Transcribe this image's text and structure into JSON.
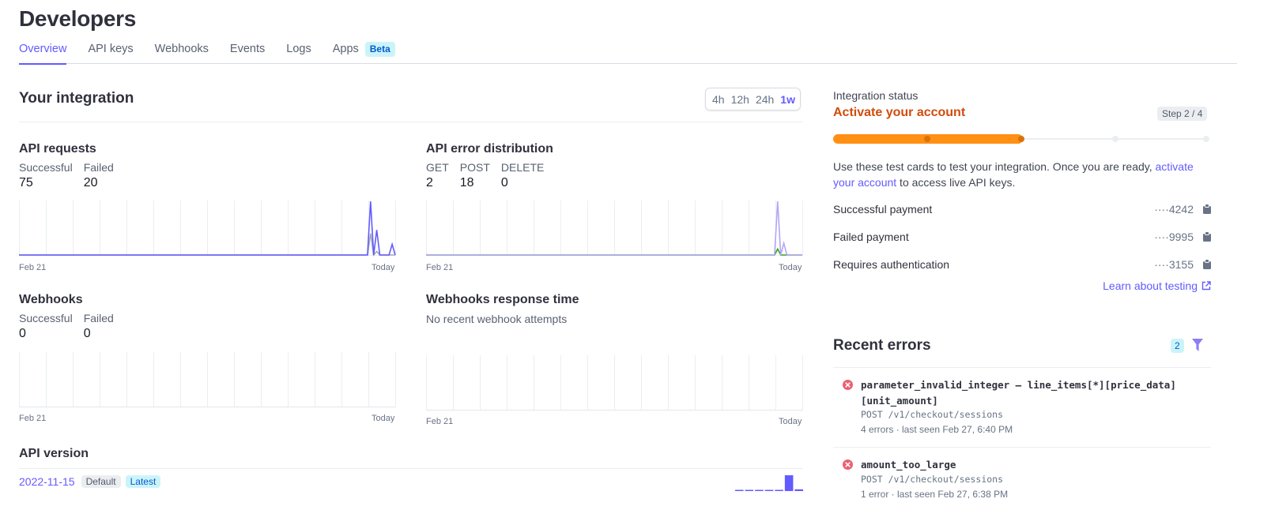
{
  "page": {
    "title": "Developers"
  },
  "tabs": [
    {
      "label": "Overview",
      "active": true
    },
    {
      "label": "API keys"
    },
    {
      "label": "Webhooks"
    },
    {
      "label": "Events"
    },
    {
      "label": "Logs"
    },
    {
      "label": "Apps",
      "badge": "Beta"
    }
  ],
  "integration": {
    "title": "Your integration",
    "ranges": [
      "4h",
      "12h",
      "24h",
      "1w"
    ],
    "active_range": "1w"
  },
  "colors": {
    "accent": "#635bff",
    "series_primary": "#635bff",
    "series_secondary": "#a3acb9",
    "series_post": "#b3a6f6",
    "series_get": "#3ba11f",
    "status_orange": "#ff9013",
    "status_title": "#d24b0b",
    "error_red": "#ed5f74"
  },
  "chart_data": [
    {
      "type": "line",
      "title": "API requests",
      "stats": [
        {
          "label": "Successful",
          "value": "75"
        },
        {
          "label": "Failed",
          "value": "20"
        }
      ],
      "x_start_label": "Feb 21",
      "x_end_label": "Today",
      "gridlines": 14,
      "ylim": [
        0,
        30
      ],
      "series": [
        {
          "name": "Successful",
          "color": "#635bff",
          "values": [
            0,
            0,
            0,
            0,
            0,
            0,
            0,
            0,
            0,
            0,
            0,
            0,
            0,
            0,
            0,
            0,
            0,
            0,
            0,
            0,
            0,
            0,
            0,
            0,
            0,
            0,
            0,
            0,
            0,
            0,
            0,
            0,
            0,
            0,
            0,
            0,
            0,
            0,
            0,
            0,
            0,
            0,
            0,
            0,
            0,
            0,
            0,
            0,
            0,
            0,
            0,
            0,
            0,
            0,
            0,
            0,
            0,
            0,
            0,
            0,
            0,
            0,
            0,
            0,
            0,
            0,
            0,
            0,
            0,
            0,
            0,
            0,
            0,
            0,
            0,
            0,
            0,
            0,
            0,
            0,
            0,
            0,
            0,
            0,
            0,
            0,
            0,
            0,
            0,
            0,
            0,
            0,
            0,
            0,
            0,
            0,
            0,
            0,
            0,
            0,
            0,
            0,
            0,
            0,
            0,
            0,
            0,
            0,
            0,
            0,
            0,
            0,
            0,
            0,
            30,
            0,
            14,
            0,
            0,
            0,
            0,
            6,
            0
          ]
        },
        {
          "name": "Failed",
          "color": "#a3acb9",
          "values": [
            0,
            0,
            0,
            0,
            0,
            0,
            0,
            0,
            0,
            0,
            0,
            0,
            0,
            0,
            0,
            0,
            0,
            0,
            0,
            0,
            0,
            0,
            0,
            0,
            0,
            0,
            0,
            0,
            0,
            0,
            0,
            0,
            0,
            0,
            0,
            0,
            0,
            0,
            0,
            0,
            0,
            0,
            0,
            0,
            0,
            0,
            0,
            0,
            0,
            0,
            0,
            0,
            0,
            0,
            0,
            0,
            0,
            0,
            0,
            0,
            0,
            0,
            0,
            0,
            0,
            0,
            0,
            0,
            0,
            0,
            0,
            0,
            0,
            0,
            0,
            0,
            0,
            0,
            0,
            0,
            0,
            0,
            0,
            0,
            0,
            0,
            0,
            0,
            0,
            0,
            0,
            0,
            0,
            0,
            0,
            0,
            0,
            0,
            0,
            0,
            0,
            0,
            0,
            0,
            0,
            0,
            0,
            0,
            0,
            0,
            0,
            0,
            0,
            0,
            12,
            0,
            2,
            0,
            0,
            0,
            0,
            0,
            0
          ]
        }
      ]
    },
    {
      "type": "line",
      "title": "API error distribution",
      "stats": [
        {
          "label": "GET",
          "value": "2"
        },
        {
          "label": "POST",
          "value": "18"
        },
        {
          "label": "DELETE",
          "value": "0"
        }
      ],
      "x_start_label": "Feb 21",
      "x_end_label": "Today",
      "gridlines": 14,
      "ylim": [
        0,
        18
      ],
      "series": [
        {
          "name": "POST",
          "color": "#b3a6f6",
          "values": [
            0,
            0,
            0,
            0,
            0,
            0,
            0,
            0,
            0,
            0,
            0,
            0,
            0,
            0,
            0,
            0,
            0,
            0,
            0,
            0,
            0,
            0,
            0,
            0,
            0,
            0,
            0,
            0,
            0,
            0,
            0,
            0,
            0,
            0,
            0,
            0,
            0,
            0,
            0,
            0,
            0,
            0,
            0,
            0,
            0,
            0,
            0,
            0,
            0,
            0,
            0,
            0,
            0,
            0,
            0,
            0,
            0,
            0,
            0,
            0,
            0,
            0,
            0,
            0,
            0,
            0,
            0,
            0,
            0,
            0,
            0,
            0,
            0,
            0,
            0,
            0,
            0,
            0,
            0,
            0,
            0,
            0,
            0,
            0,
            0,
            0,
            0,
            0,
            0,
            0,
            0,
            0,
            0,
            0,
            0,
            0,
            0,
            0,
            0,
            0,
            0,
            0,
            0,
            0,
            0,
            0,
            0,
            0,
            0,
            0,
            0,
            0,
            0,
            0,
            18,
            0,
            4,
            0,
            0,
            0,
            0,
            0,
            0
          ]
        },
        {
          "name": "GET",
          "color": "#3ba11f",
          "values": [
            0,
            0,
            0,
            0,
            0,
            0,
            0,
            0,
            0,
            0,
            0,
            0,
            0,
            0,
            0,
            0,
            0,
            0,
            0,
            0,
            0,
            0,
            0,
            0,
            0,
            0,
            0,
            0,
            0,
            0,
            0,
            0,
            0,
            0,
            0,
            0,
            0,
            0,
            0,
            0,
            0,
            0,
            0,
            0,
            0,
            0,
            0,
            0,
            0,
            0,
            0,
            0,
            0,
            0,
            0,
            0,
            0,
            0,
            0,
            0,
            0,
            0,
            0,
            0,
            0,
            0,
            0,
            0,
            0,
            0,
            0,
            0,
            0,
            0,
            0,
            0,
            0,
            0,
            0,
            0,
            0,
            0,
            0,
            0,
            0,
            0,
            0,
            0,
            0,
            0,
            0,
            0,
            0,
            0,
            0,
            0,
            0,
            0,
            0,
            0,
            0,
            0,
            0,
            0,
            0,
            0,
            0,
            0,
            0,
            0,
            0,
            0,
            0,
            0,
            2,
            0,
            0,
            0,
            0,
            0,
            0,
            0,
            0
          ]
        },
        {
          "name": "DELETE",
          "color": "#d8dbe3",
          "values": []
        }
      ]
    },
    {
      "type": "line",
      "title": "Webhooks",
      "stats": [
        {
          "label": "Successful",
          "value": "0"
        },
        {
          "label": "Failed",
          "value": "0"
        }
      ],
      "x_start_label": "Feb 21",
      "x_end_label": "Today",
      "gridlines": 14,
      "series": []
    },
    {
      "type": "line",
      "title": "Webhooks response time",
      "empty_message": "No recent webhook attempts",
      "x_start_label": "Feb 21",
      "x_end_label": "Today",
      "gridlines": 14,
      "series": []
    },
    {
      "type": "bar",
      "title": "API version usage sparkline",
      "values": [
        1,
        1,
        1,
        1,
        1,
        18,
        2
      ],
      "color": "#635bff"
    }
  ],
  "api_version": {
    "title": "API version",
    "version": "2022-11-15",
    "badges": [
      "Default",
      "Latest"
    ]
  },
  "integration_status": {
    "label": "Integration status",
    "title": "Activate your account",
    "step": "Step 2 / 4",
    "current_step": 2,
    "total_steps": 4,
    "description_before": "Use these test cards to test your integration. Once you are ready, ",
    "description_link": "activate your account",
    "description_after": " to access live API keys.",
    "test_cards": [
      {
        "label": "Successful payment",
        "number": "····4242"
      },
      {
        "label": "Failed payment",
        "number": "····9995"
      },
      {
        "label": "Requires authentication",
        "number": "····3155"
      }
    ],
    "learn_link": "Learn about testing"
  },
  "recent_errors": {
    "title": "Recent errors",
    "count": "2",
    "items": [
      {
        "code": "parameter_invalid_integer – line_items[*][price_data][unit_amount]",
        "endpoint": "POST /v1/checkout/sessions",
        "meta": "4 errors · last seen Feb 27, 6:40 PM"
      },
      {
        "code": "amount_too_large",
        "endpoint": "POST /v1/checkout/sessions",
        "meta": "1 error · last seen Feb 27, 6:38 PM"
      }
    ]
  }
}
